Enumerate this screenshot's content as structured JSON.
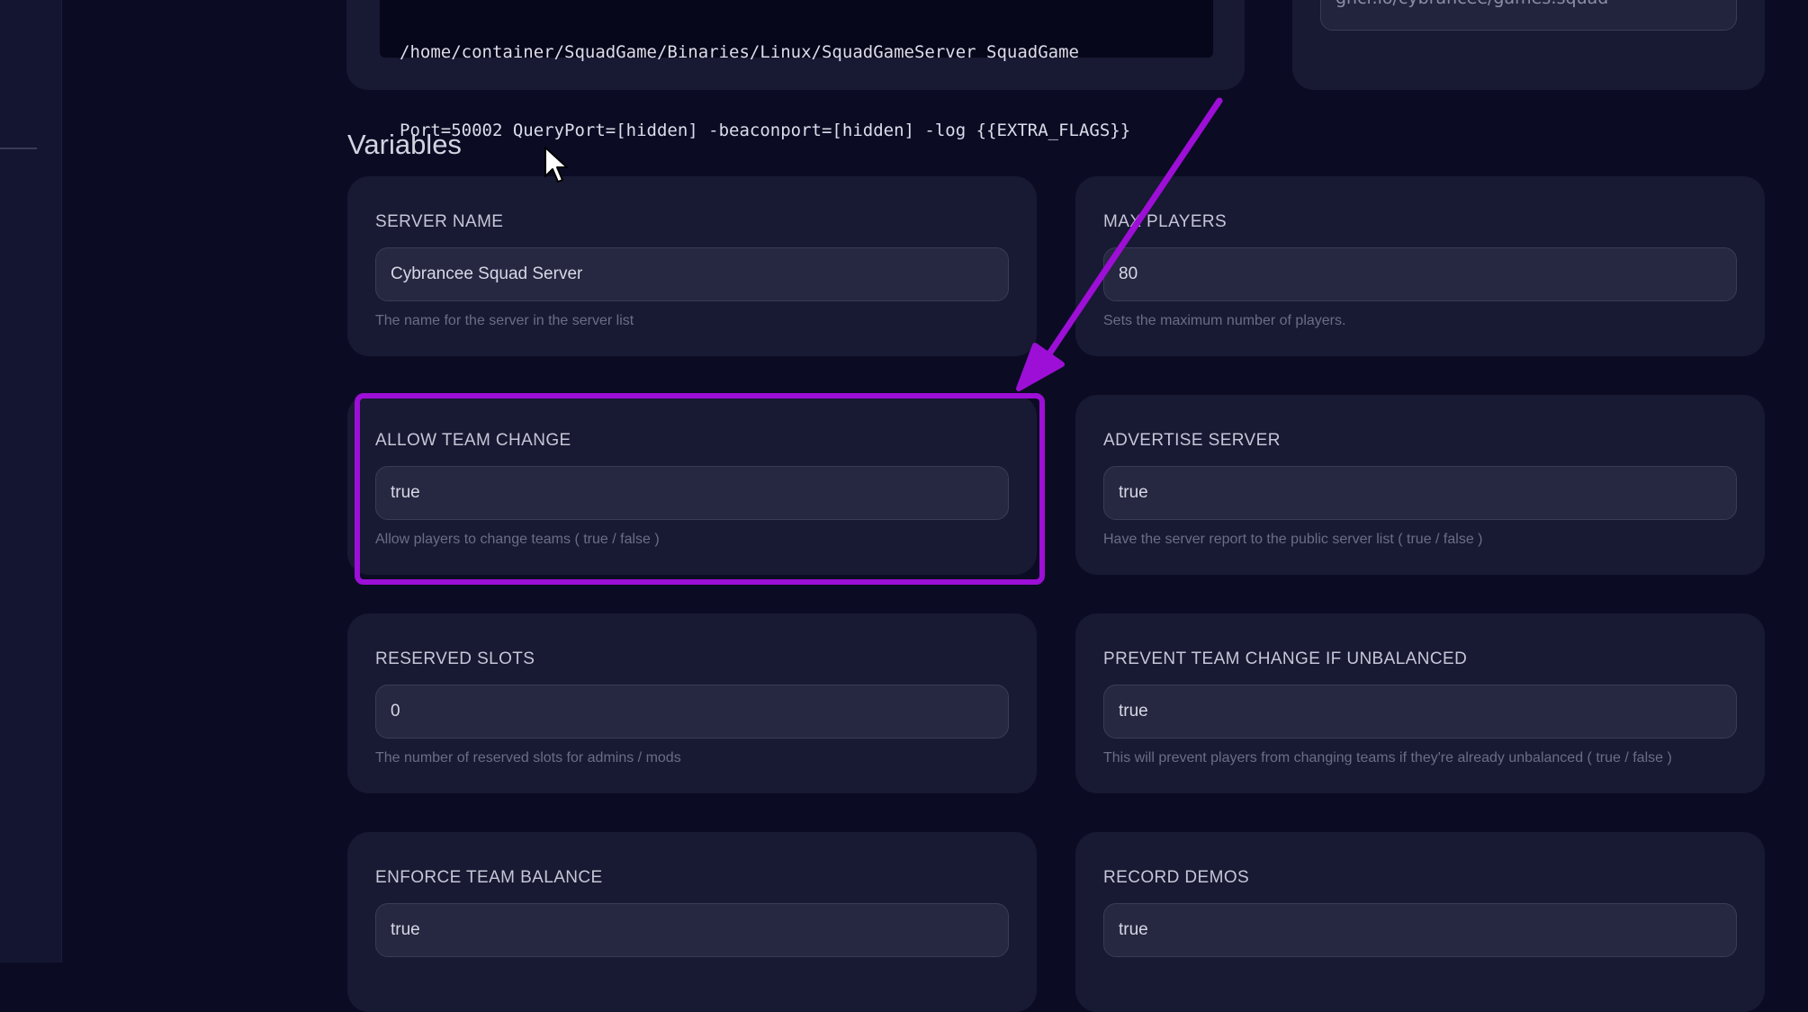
{
  "startup": {
    "command_line_1": "/home/container/SquadGame/Binaries/Linux/SquadGameServer SquadGame",
    "command_line_2": "Port=50002 QueryPort=[hidden] -beaconport=[hidden] -log {{EXTRA_FLAGS}}"
  },
  "docker": {
    "image_value": "ghcr.io/cybrancee/games:squad"
  },
  "variables": {
    "title": "Variables",
    "items": [
      {
        "label": "SERVER NAME",
        "value": "Cybrancee Squad Server",
        "help": "The name for the server in the server list"
      },
      {
        "label": "MAX PLAYERS",
        "value": "80",
        "help": "Sets the maximum number of players."
      },
      {
        "label": "ALLOW TEAM CHANGE",
        "value": "true",
        "help": "Allow players to change teams ( true / false )"
      },
      {
        "label": "ADVERTISE SERVER",
        "value": "true",
        "help": "Have the server report to the public server list ( true / false )"
      },
      {
        "label": "RESERVED SLOTS",
        "value": "0",
        "help": "The number of reserved slots for admins / mods"
      },
      {
        "label": "PREVENT TEAM CHANGE IF UNBALANCED",
        "value": "true",
        "help": "This will prevent players from changing teams if they're already unbalanced ( true / false )"
      },
      {
        "label": "ENFORCE TEAM BALANCE",
        "value": "true",
        "help": ""
      },
      {
        "label": "RECORD DEMOS",
        "value": "true",
        "help": ""
      }
    ]
  },
  "annotation": {
    "highlight_color": "#9d0fd6",
    "arrow_color": "#9d0fd6"
  },
  "colors": {
    "background": "#0b0c24",
    "card": "#181932",
    "input": "#262740"
  }
}
